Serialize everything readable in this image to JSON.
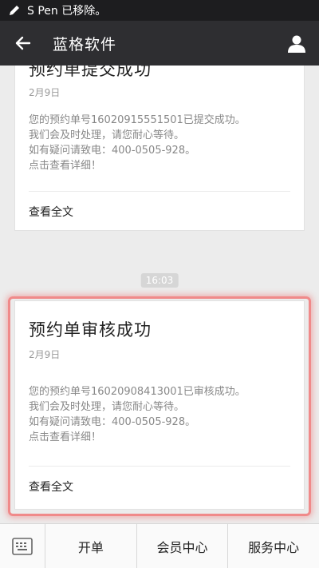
{
  "status_bar": {
    "message": "S Pen 已移除。",
    "icon": "pen-icon"
  },
  "app_bar": {
    "title": "蓝格软件",
    "back_icon": "back-arrow-icon",
    "profile_icon": "profile-icon"
  },
  "messages": [
    {
      "title": "预约单提交成功",
      "date": "2月9日",
      "lines": [
        "您的预约单号16020915551501已提交成功。",
        "我们会及时处理，请您耐心等待。",
        "如有疑问请致电：400-0505-928。",
        "点击查看详细！"
      ],
      "read_more": "查看全文"
    },
    {
      "title": "预约单审核成功",
      "date": "2月9日",
      "lines": [
        "您的预约单号16020908413001已审核成功。",
        "我们会及时处理，请您耐心等待。",
        "如有疑问请致电：400-0505-928。",
        "点击查看详细！"
      ],
      "read_more": "查看全文"
    }
  ],
  "timestamp": "16:03",
  "bottom_menu": {
    "keyboard_icon": "keyboard-icon",
    "items": [
      "开单",
      "会员中心",
      "服务中心"
    ]
  },
  "colors": {
    "status_bar": "#1d1d1f",
    "app_bar": "#2e2e31",
    "background": "#ececec",
    "highlight": "#f08a8a"
  }
}
